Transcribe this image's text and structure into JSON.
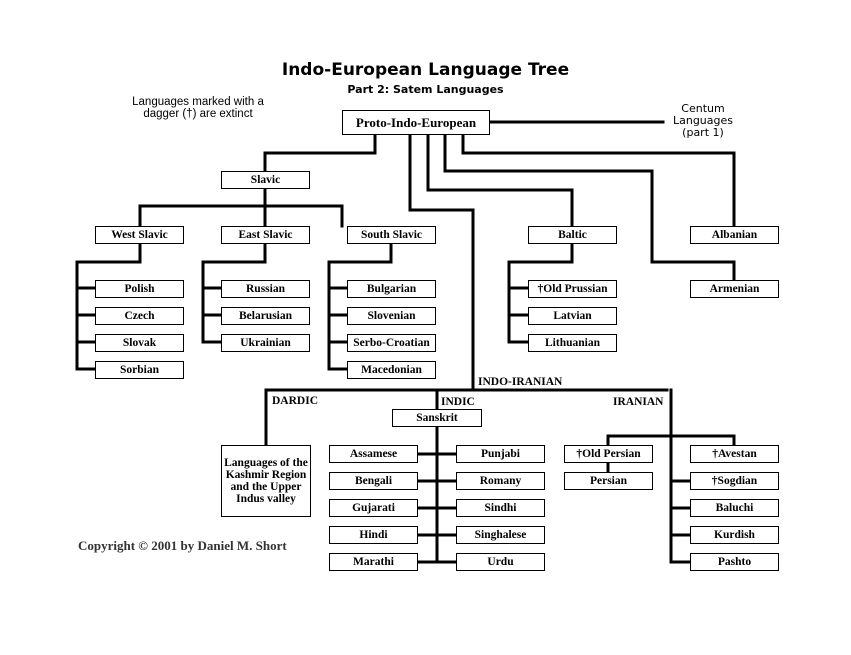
{
  "title": "Indo-European Language Tree",
  "subtitle": "Part 2: Satem Languages",
  "note": "Languages marked with a dagger (†) are extinct",
  "centum_label": "Centum Languages (part 1)",
  "root": "Proto-Indo-European",
  "slavic": {
    "label": "Slavic",
    "west": {
      "label": "West Slavic",
      "languages": [
        "Polish",
        "Czech",
        "Slovak",
        "Sorbian"
      ]
    },
    "east": {
      "label": "East Slavic",
      "languages": [
        "Russian",
        "Belarusian",
        "Ukrainian"
      ]
    },
    "south": {
      "label": "South Slavic",
      "languages": [
        "Bulgarian",
        "Slovenian",
        "Serbo-Croatian",
        "Macedonian"
      ]
    }
  },
  "baltic": {
    "label": "Baltic",
    "languages": [
      "†Old Prussian",
      "Latvian",
      "Lithuanian"
    ]
  },
  "albanian": "Albanian",
  "armenian": "Armenian",
  "indo_iranian": {
    "label": "INDO-IRANIAN",
    "dardic": {
      "label": "DARDIC",
      "description": "Languages of the Kashmir Region and the Upper Indus valley"
    },
    "indic": {
      "label": "INDIC",
      "sanskrit": "Sanskrit",
      "left": [
        "Assamese",
        "Bengali",
        "Gujarati",
        "Hindi",
        "Marathi"
      ],
      "right": [
        "Punjabi",
        "Romany",
        "Sindhi",
        "Singhalese",
        "Urdu"
      ]
    },
    "iranian": {
      "label": "IRANIAN",
      "old_persian": "†Old Persian",
      "persian": "Persian",
      "avestan": "†Avestan",
      "others": [
        "†Sogdian",
        "Baluchi",
        "Kurdish",
        "Pashto"
      ]
    }
  },
  "copyright": "Copyright © 2001 by Daniel M. Short"
}
